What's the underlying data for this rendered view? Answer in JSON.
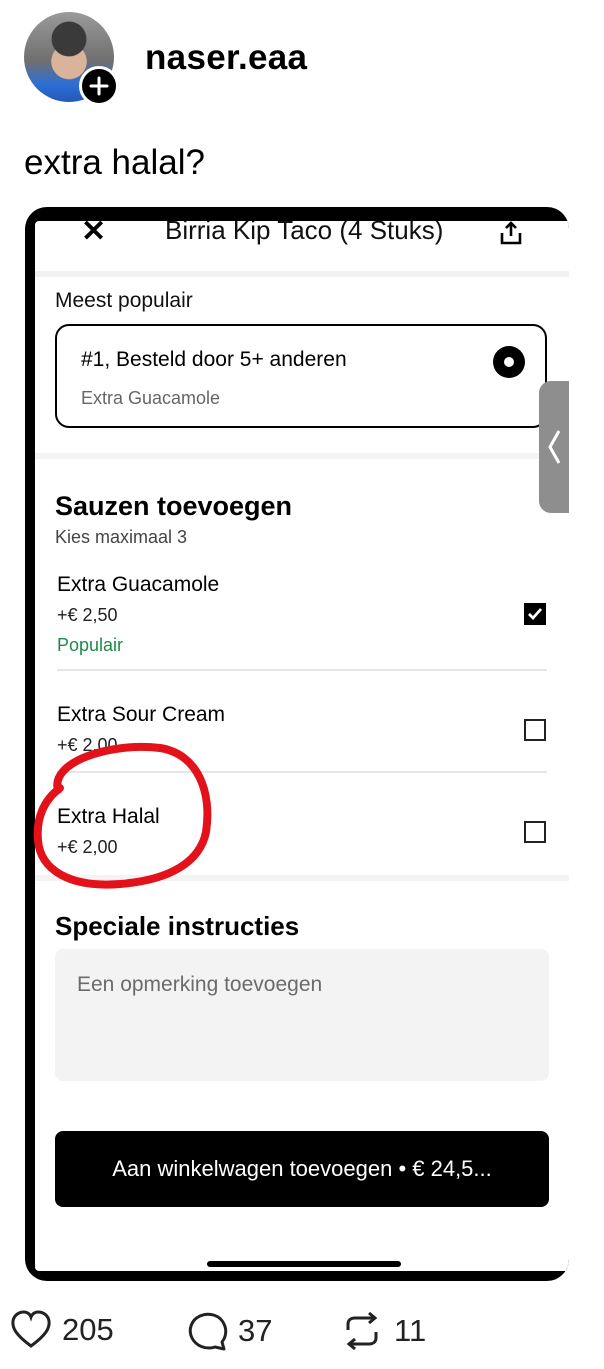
{
  "post": {
    "username": "naser.eaa",
    "caption": "extra halal?"
  },
  "app": {
    "title": "Birria Kip Taco (4 Stuks)",
    "close_glyph": "✕",
    "popular_section": {
      "label": "Meest populair",
      "card_title": "#1, Besteld door 5+ anderen",
      "card_subtitle": "Extra Guacamole"
    },
    "sauces": {
      "heading": "Sauzen toevoegen",
      "subheading": "Kies maximaal 3",
      "options": [
        {
          "name": "Extra Guacamole",
          "price": "+€ 2,50",
          "tag": "Populair",
          "checked": true
        },
        {
          "name": "Extra Sour Cream",
          "price": "+€ 2,00",
          "checked": false
        },
        {
          "name": "Extra Halal",
          "price": "+€ 2,00",
          "checked": false
        }
      ]
    },
    "instructions": {
      "heading": "Speciale instructies",
      "placeholder": "Een opmerking toevoegen"
    },
    "cta_label": "Aan winkelwagen toevoegen • € 24,5..."
  },
  "stats": {
    "likes": "205",
    "comments": "37",
    "reposts": "11"
  },
  "colors": {
    "accent_green": "#1e8a4a",
    "annotation_red": "#e3121a"
  }
}
